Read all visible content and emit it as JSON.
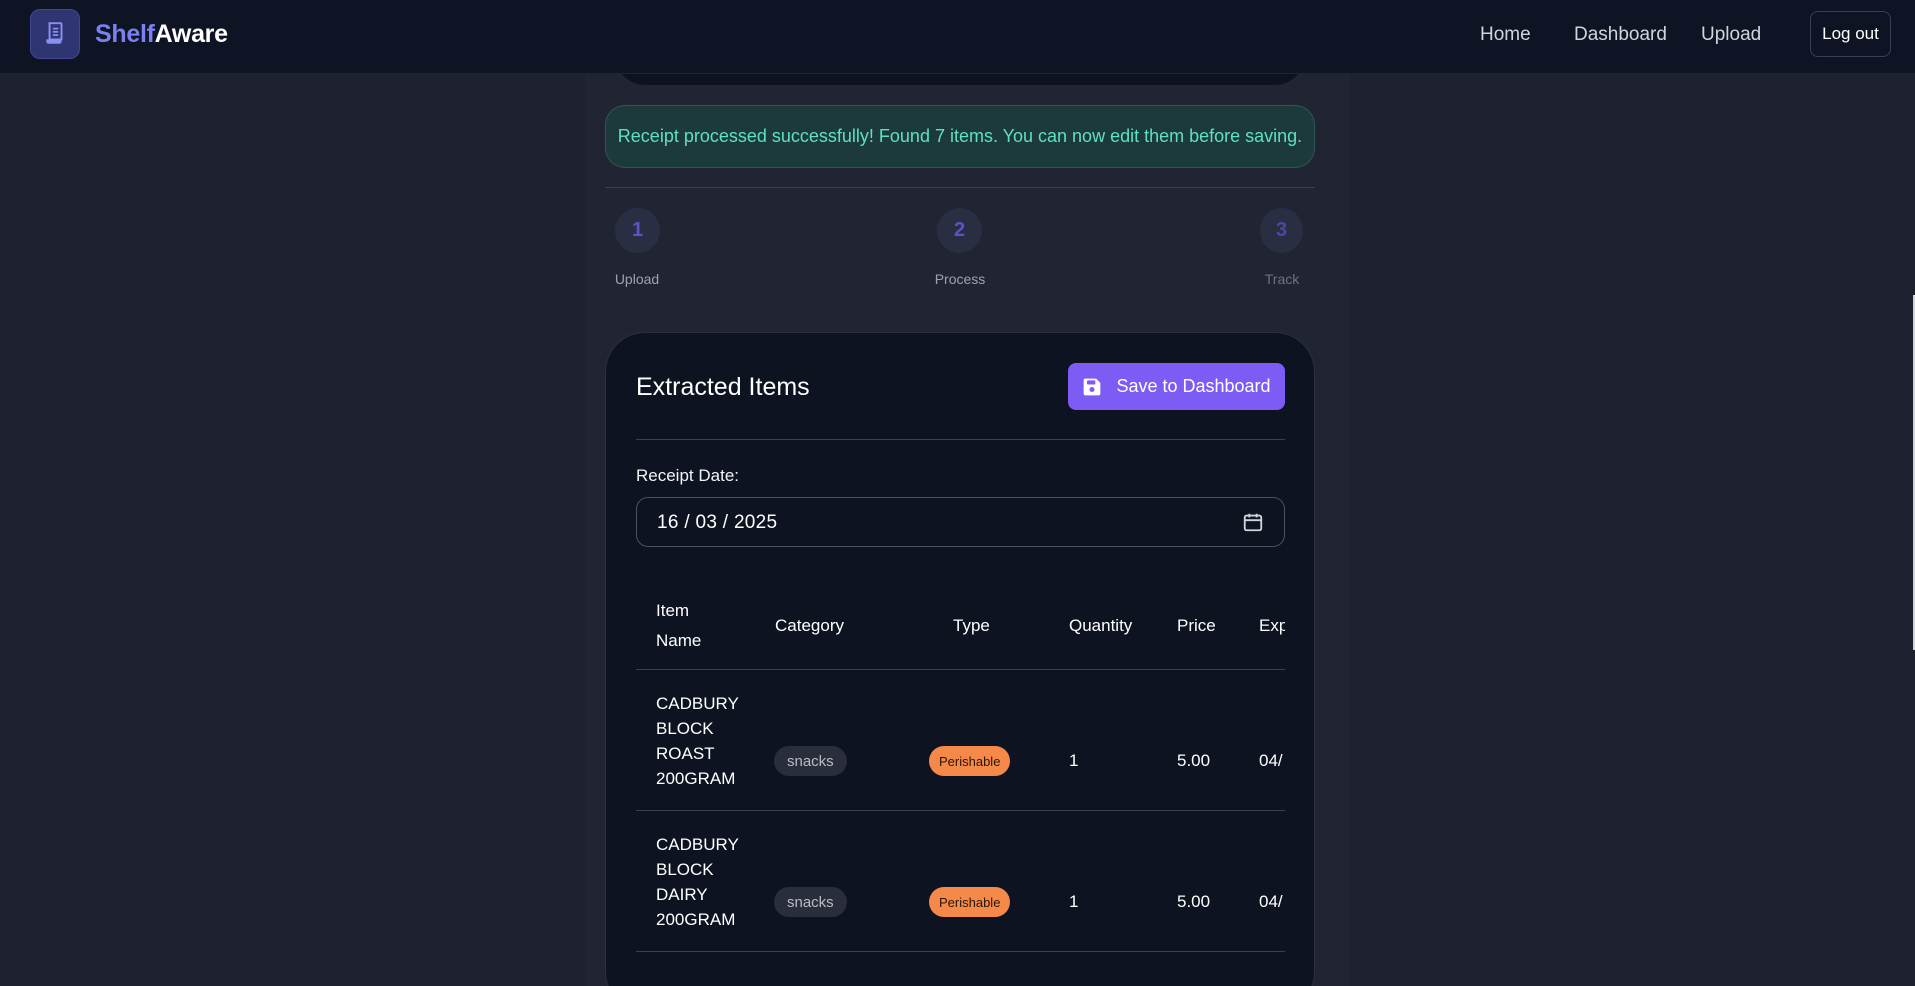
{
  "brand": {
    "part1": "Shelf",
    "part2": "Aware",
    "icon": "receipt-icon"
  },
  "nav": {
    "home": "Home",
    "dashboard": "Dashboard",
    "upload": "Upload",
    "logout": "Log out"
  },
  "alert": {
    "message": "Receipt processed successfully! Found 7 items. You can now edit them before saving."
  },
  "steps": [
    {
      "number": "1",
      "label": "Upload"
    },
    {
      "number": "2",
      "label": "Process"
    },
    {
      "number": "3",
      "label": "Track"
    }
  ],
  "card": {
    "title": "Extracted Items",
    "save_label": "Save to Dashboard",
    "save_icon": "floppy-disk-icon",
    "date_label": "Receipt Date:",
    "date_value": "16 / 03 / 2025",
    "date_icon": "calendar-icon"
  },
  "table": {
    "headers": {
      "name_line1": "Item",
      "name_line2": "Name",
      "category": "Category",
      "type": "Type",
      "quantity": "Quantity",
      "price": "Price",
      "expiry": "Exp"
    },
    "rows": [
      {
        "name": [
          "CADBURY",
          "BLOCK",
          "ROAST",
          "200GRAM"
        ],
        "category": "snacks",
        "type": "Perishable",
        "quantity": "1",
        "price": "5.00",
        "expiry": "04/"
      },
      {
        "name": [
          "CADBURY",
          "BLOCK",
          "DAIRY",
          "200GRAM"
        ],
        "category": "snacks",
        "type": "Perishable",
        "quantity": "1",
        "price": "5.00",
        "expiry": "04/"
      }
    ]
  },
  "colors": {
    "accent": "#7c5cf5",
    "success_text": "#5ee0c3",
    "perishable": "#f5894a",
    "background": "#1e2130"
  }
}
